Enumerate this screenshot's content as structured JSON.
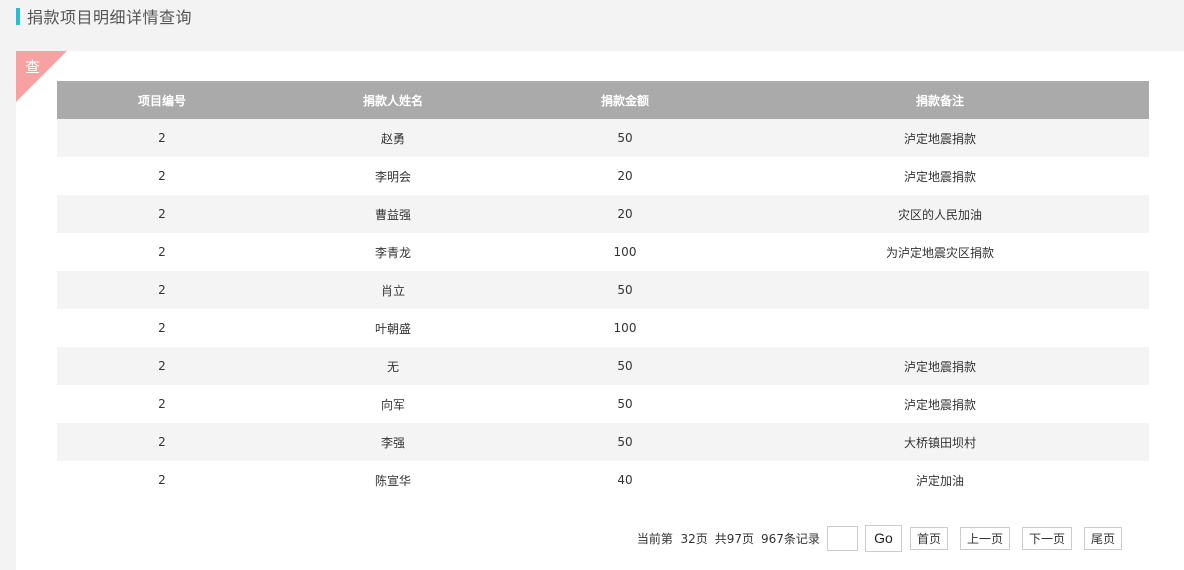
{
  "header": {
    "title": "捐款项目明细详情查询"
  },
  "panel": {
    "corner_label": "查"
  },
  "table": {
    "columns": [
      "项目编号",
      "捐款人姓名",
      "捐款金额",
      "捐款备注"
    ],
    "rows": [
      [
        "2",
        "赵勇",
        "50",
        "泸定地震捐款"
      ],
      [
        "2",
        "李明会",
        "20",
        "泸定地震捐款"
      ],
      [
        "2",
        "曹益强",
        "20",
        "灾区的人民加油"
      ],
      [
        "2",
        "李青龙",
        "100",
        "为泸定地震灾区捐款"
      ],
      [
        "2",
        "肖立",
        "50",
        ""
      ],
      [
        "2",
        "叶朝盛",
        "100",
        ""
      ],
      [
        "2",
        "无",
        "50",
        "泸定地震捐款"
      ],
      [
        "2",
        "向军",
        "50",
        "泸定地震捐款"
      ],
      [
        "2",
        "李强",
        "50",
        "大桥镇田坝村"
      ],
      [
        "2",
        "陈宣华",
        "40",
        "泸定加油"
      ]
    ]
  },
  "pager": {
    "current_page_text": "当前第  32页",
    "total_pages_text": "共97页",
    "total_records_text": "967条记录",
    "page_input_value": "",
    "go_label": "Go",
    "first_label": "首页",
    "prev_label": "上一页",
    "next_label": "下一页",
    "last_label": "尾页"
  }
}
